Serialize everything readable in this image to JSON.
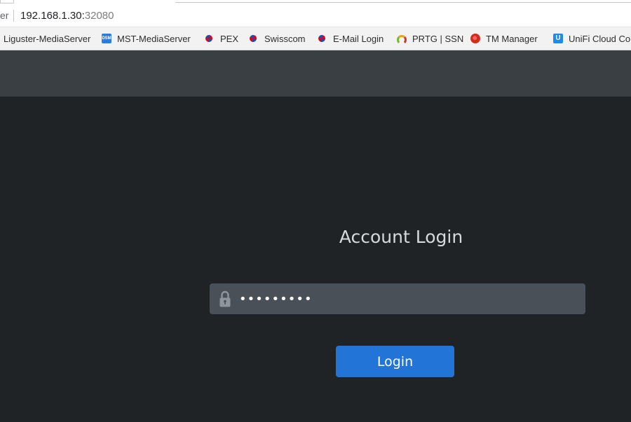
{
  "browser": {
    "site_name_fragment": "er",
    "url_host": "192.168.1.30:",
    "url_port": "32080"
  },
  "bookmarks": [
    {
      "label": "Liguster-MediaServer",
      "icon": "none"
    },
    {
      "label": "MST-MediaServer",
      "icon": "dsm-icon",
      "icon_text": "DSM"
    },
    {
      "label": "PEX",
      "icon": "swisscom-icon"
    },
    {
      "label": "Swisscom",
      "icon": "swisscom-icon"
    },
    {
      "label": "E-Mail Login",
      "icon": "swisscom-icon"
    },
    {
      "label": "PRTG | SSN",
      "icon": "prtg-icon"
    },
    {
      "label": "TM Manager",
      "icon": "trendmicro-icon"
    },
    {
      "label": "UniFi Cloud Co",
      "icon": "unifi-icon",
      "icon_text": "U"
    }
  ],
  "login": {
    "title": "Account Login",
    "password_value": "*********",
    "button_label": "Login"
  },
  "colors": {
    "page_background": "#202326",
    "header_bar": "#3a3f44",
    "input_background": "#4a5057",
    "button_primary": "#2275d7"
  }
}
